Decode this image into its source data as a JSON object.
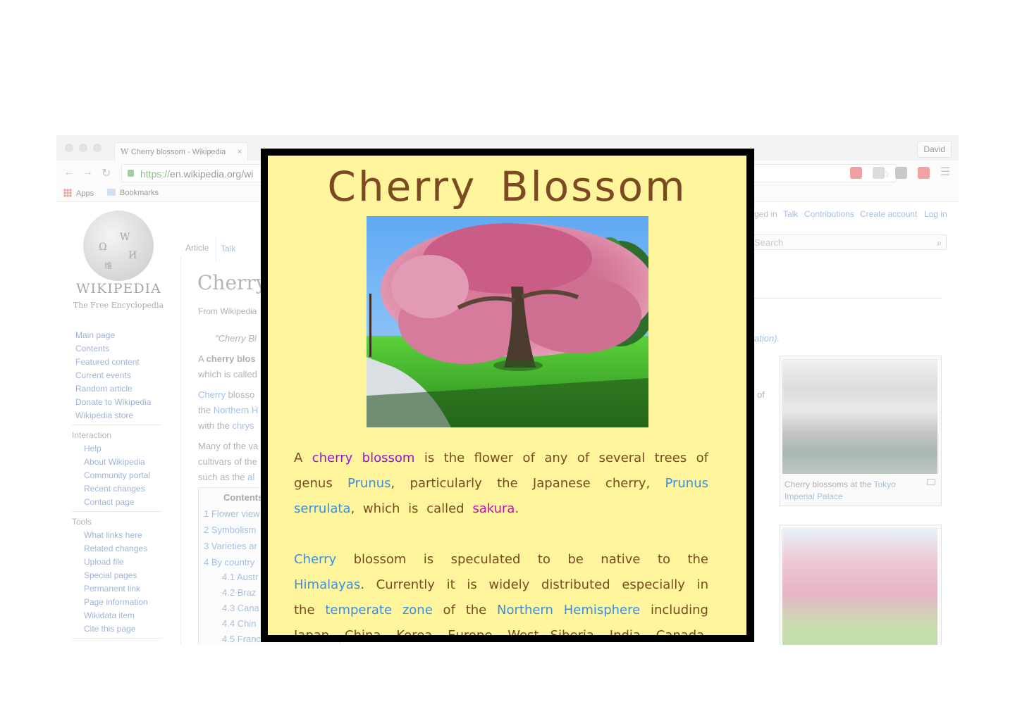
{
  "browser": {
    "tab_title": "Cherry blossom - Wikipedia",
    "tab_close": "×",
    "user": "David",
    "nav": {
      "back": "←",
      "forward": "→",
      "reload": "↻"
    },
    "url_scheme": "https://",
    "url_rest": "en.wikipedia.org/wi",
    "bookmarks": [
      "Apps",
      "Bookmarks"
    ],
    "extension_colors": [
      "#f0a0a0",
      "#dcdcdc",
      "#c8c8c8",
      "#f3a2a2",
      "#c7c7c7"
    ]
  },
  "wiki": {
    "logo_glyphs": [
      "Ω",
      "W",
      "И",
      "维"
    ],
    "wordmark": "WIKIPEDIA",
    "tagline": "The Free Encyclopedia",
    "nav_links": [
      "Main page",
      "Contents",
      "Featured content",
      "Current events",
      "Random article",
      "Donate to Wikipedia",
      "Wikipedia store"
    ],
    "interaction_heading": "Interaction",
    "interaction_links": [
      "Help",
      "About Wikipedia",
      "Community portal",
      "Recent changes",
      "Contact page"
    ],
    "tools_heading": "Tools",
    "tools_links": [
      "What links here",
      "Related changes",
      "Upload file",
      "Special pages",
      "Permanent link",
      "Page information",
      "Wikidata item",
      "Cite this page"
    ],
    "tabs": [
      "Article",
      "Talk"
    ],
    "personal": [
      "ged in",
      "Talk",
      "Contributions",
      "Create account",
      "Log in"
    ],
    "search_placeholder": "Search",
    "search_icon": "⌕",
    "title_fragment": "Cherry",
    "from_fragment": "From Wikipedia",
    "hatnote_left": "\"Cherry Bl",
    "hatnote_right": "ation).",
    "lines": [
      {
        "a": "A ",
        "b": "cherry blos",
        "c": ""
      },
      {
        "a": "which is called",
        "b": "",
        "c": ""
      },
      {
        "a": "",
        "b": "Cherry",
        "c": " blosso"
      },
      {
        "a": "the ",
        "b": "Northern H",
        "c": ""
      },
      {
        "a": "with the ",
        "b": "chrys",
        "c": ""
      },
      {
        "a": "Many of the va",
        "b": "",
        "c": ""
      },
      {
        "a": "cultivars of the",
        "b": "",
        "c": ""
      },
      {
        "a": "such as the ",
        "b": "al",
        "c": ""
      }
    ],
    "right_fragment": "of",
    "toc_title": "Contents",
    "toc": [
      {
        "num": "1",
        "label": "Flower view"
      },
      {
        "num": "2",
        "label": "Symbolism"
      },
      {
        "num": "3",
        "label": "Varieties ar"
      },
      {
        "num": "4",
        "label": "By country"
      },
      {
        "num": "4.1",
        "label": "Austr"
      },
      {
        "num": "4.2",
        "label": "Braz"
      },
      {
        "num": "4.3",
        "label": "Cana"
      },
      {
        "num": "4.4",
        "label": "Chin"
      },
      {
        "num": "4.5",
        "label": "France"
      }
    ],
    "caption": {
      "pre": "Cherry blossoms at the ",
      "link": "Tokyo Imperial Palace"
    }
  },
  "card": {
    "title": "Cherry Blossom",
    "p1": [
      {
        "t": "A ",
        "c": "brown"
      },
      {
        "t": "cherry",
        "c": "purple"
      },
      {
        "t": " ",
        "c": "brown"
      },
      {
        "t": "blossom",
        "c": "purple"
      },
      {
        "t": " is the flower of any of several trees of genus ",
        "c": "brown"
      },
      {
        "t": "Prunus",
        "c": "blue"
      },
      {
        "t": ", particularly the Japanese cherry, ",
        "c": "brown"
      },
      {
        "t": "Prunus serrulata",
        "c": "blue"
      },
      {
        "t": ", which is called ",
        "c": "brown"
      },
      {
        "t": "sakura",
        "c": "magenta"
      },
      {
        "t": ".",
        "c": "brown"
      }
    ],
    "p2": [
      {
        "t": "Cherry",
        "c": "blue"
      },
      {
        "t": " blossom is speculated to be native to the ",
        "c": "brown"
      },
      {
        "t": "Himalayas",
        "c": "blue"
      },
      {
        "t": ". Currently it is widely distributed especially in the ",
        "c": "brown"
      },
      {
        "t": "temperate zone",
        "c": "blue"
      },
      {
        "t": " of the ",
        "c": "brown"
      },
      {
        "t": "Northern Hemisphere",
        "c": "blue"
      },
      {
        "t": " including Japan, China, Korea, Europe, West Siberia, India, Canada, and the United States.",
        "c": "brown"
      }
    ]
  }
}
